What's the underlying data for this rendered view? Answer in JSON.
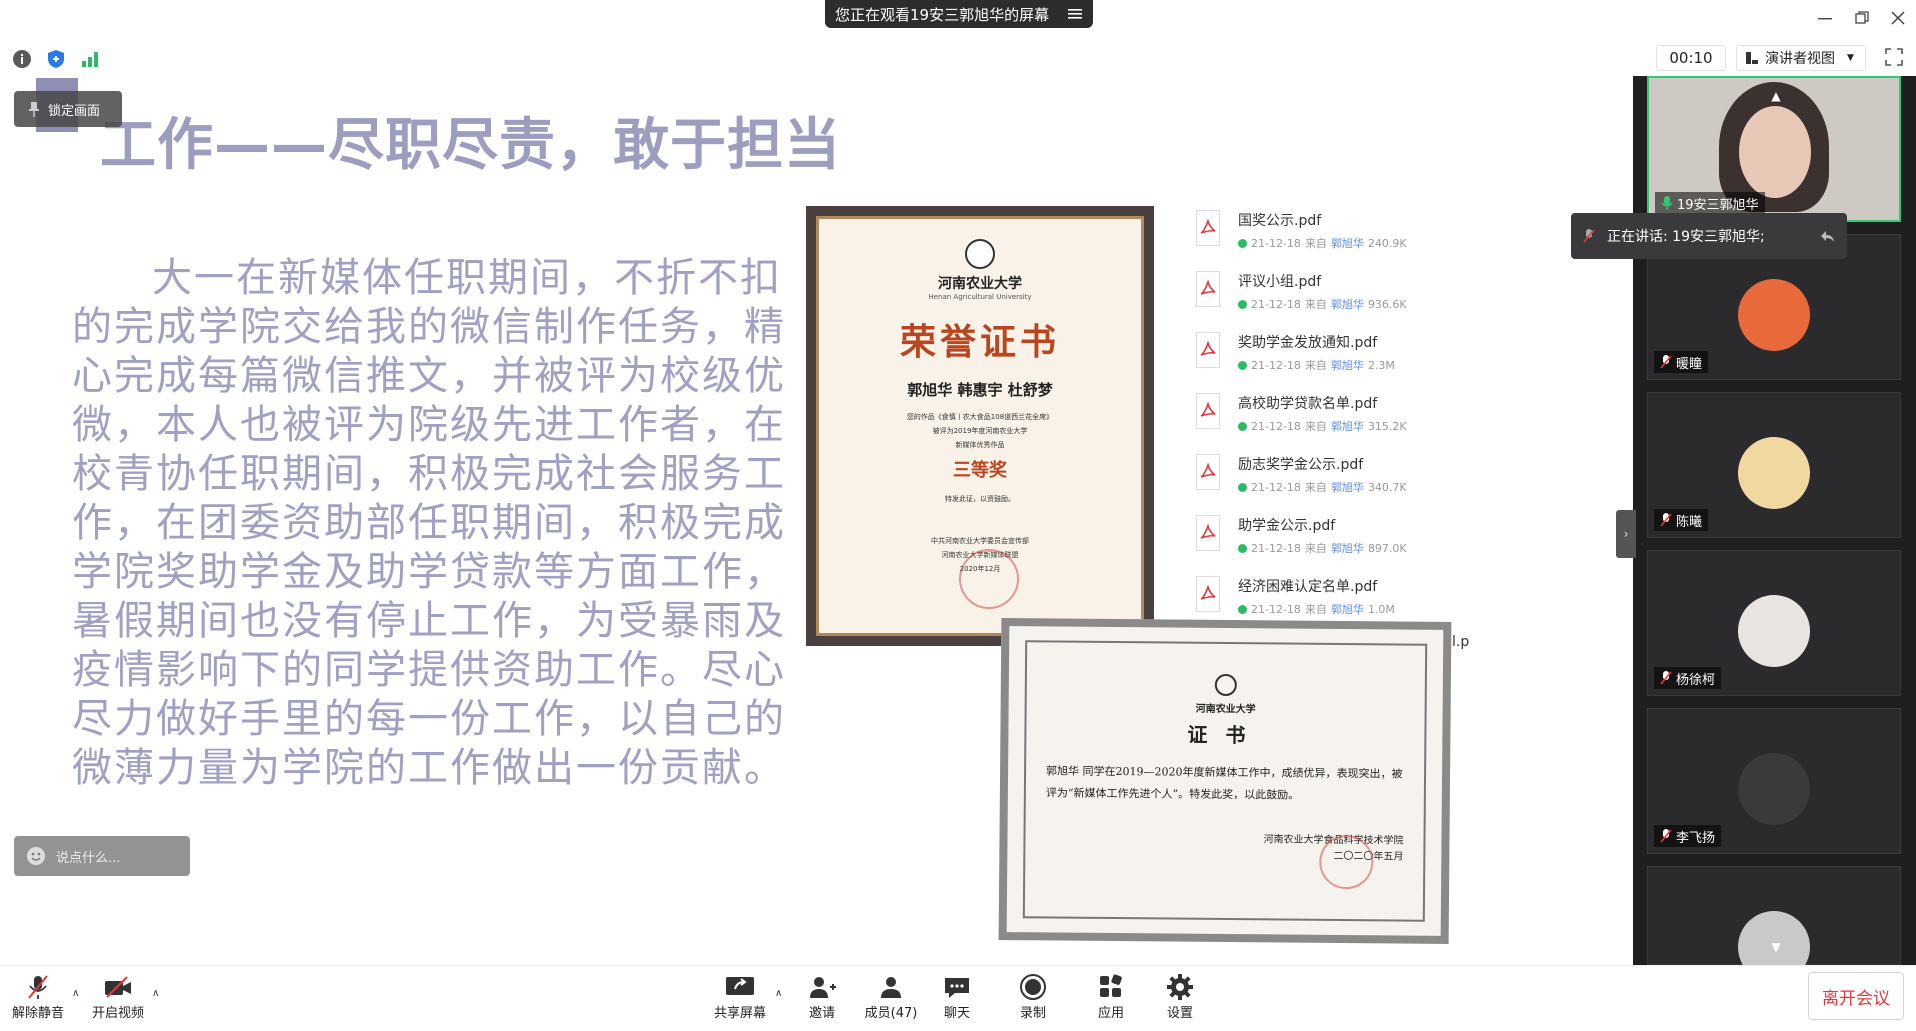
{
  "window": {
    "share_banner": "您正在观看19安三郭旭华的屏幕"
  },
  "toolbar_top": {
    "timer": "00:10",
    "view_label": "演讲者视图"
  },
  "slide": {
    "lock_label": "锁定画面",
    "title": "工作——尽职尽责，敢于担当",
    "body": "大一在新媒体任职期间，不折不扣的完成学院交给我的微信制作任务，精心完成每篇微信推文，并被评为校级优微，本人也被评为院级先进工作者，在校青协任职期间，积极完成社会服务工作，在团委资助部任职期间，积极完成学院奖助学金及助学贷款等方面工作，暑假期间也没有停止工作，为受暴雨及疫情影响下的同学提供资助工作。尽心尽力做好手里的每一份工作，以自己的微薄力量为学院的工作做出一份贡献。",
    "comment_placeholder": "说点什么...",
    "cert1": {
      "school": "河南农业大学",
      "school_en": "Henan Agricultural University",
      "heading": "荣誉证书",
      "names": "郭旭华  韩惠宇  杜舒梦",
      "line1": "您的作品《食慎丨农大食品108道西兰花全席》",
      "line2": "被评为2019年度河南农业大学",
      "line3": "新媒体优秀作品",
      "prize": "三等奖",
      "line4": "特发此证，以资鼓励。",
      "sign1": "中共河南农业大学委员会宣传部",
      "sign2": "河南农业大学新媒体联盟",
      "sign_date": "2020年12月"
    },
    "cert2": {
      "school": "河南农业大学",
      "heading": "证书",
      "body": "郭旭华 同学在2019—2020年度新媒体工作中，成绩优异，表现突出，被评为“新媒体工作先进个人”。特发此奖，以此鼓励。",
      "sign1": "河南农业大学食品科学技术学院",
      "sign_date": "二〇二〇年五月"
    },
    "files": [
      {
        "name": "国奖公示.pdf",
        "date": "21-12-18",
        "from_prefix": "来自",
        "from": "郭旭华",
        "size": "240.9K"
      },
      {
        "name": "评议小组.pdf",
        "date": "21-12-18",
        "from_prefix": "来自",
        "from": "郭旭华",
        "size": "936.6K"
      },
      {
        "name": "奖助学金发放通知.pdf",
        "date": "21-12-18",
        "from_prefix": "来自",
        "from": "郭旭华",
        "size": "2.3M"
      },
      {
        "name": "高校助学贷款名单.pdf",
        "date": "21-12-18",
        "from_prefix": "来自",
        "from": "郭旭华",
        "size": "315.2K"
      },
      {
        "name": "励志奖学金公示.pdf",
        "date": "21-12-18",
        "from_prefix": "来自",
        "from": "郭旭华",
        "size": "340.7K"
      },
      {
        "name": "助学金公示.pdf",
        "date": "21-12-18",
        "from_prefix": "来自",
        "from": "郭旭华",
        "size": "897.0K"
      },
      {
        "name": "经济困难认定名单.pdf",
        "date": "21-12-18",
        "from_prefix": "来自",
        "from": "郭旭华",
        "size": "1.0M"
      }
    ],
    "partial_file": "l.p"
  },
  "participants": {
    "speaking_label": "正在讲话: 19安三郭旭华;",
    "tiles": [
      {
        "name": "19安三郭旭华"
      },
      {
        "name": "暖瞳"
      },
      {
        "name": "陈曦"
      },
      {
        "name": "杨徐柯"
      },
      {
        "name": "李飞扬"
      },
      {
        "name": ""
      }
    ]
  },
  "bottombar": {
    "unmute": "解除静音",
    "start_video": "开启视频",
    "share": "共享屏幕",
    "invite": "邀请",
    "members": "成员(47)",
    "chat": "聊天",
    "record": "录制",
    "apps": "应用",
    "settings": "设置",
    "leave": "离开会议"
  },
  "colors": {
    "accent_green": "#2ecc71",
    "leave_red": "#e0383e",
    "slide_text": "#a0a0c2",
    "cert_red": "#b9461f"
  }
}
